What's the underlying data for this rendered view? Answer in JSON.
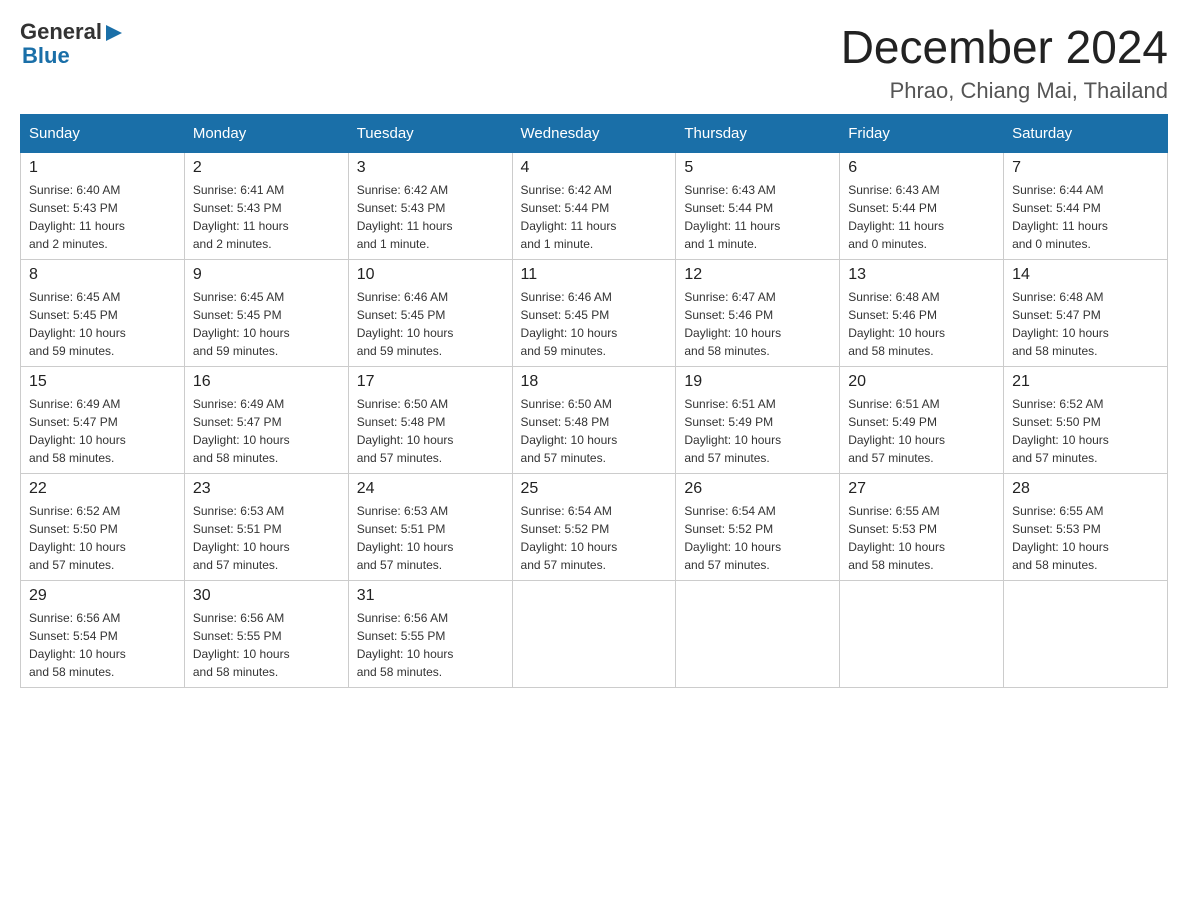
{
  "header": {
    "logo_general": "General",
    "logo_blue": "Blue",
    "month_title": "December 2024",
    "location": "Phrao, Chiang Mai, Thailand"
  },
  "days_of_week": [
    "Sunday",
    "Monday",
    "Tuesday",
    "Wednesday",
    "Thursday",
    "Friday",
    "Saturday"
  ],
  "weeks": [
    [
      {
        "day": "1",
        "sunrise": "6:40 AM",
        "sunset": "5:43 PM",
        "daylight": "11 hours and 2 minutes."
      },
      {
        "day": "2",
        "sunrise": "6:41 AM",
        "sunset": "5:43 PM",
        "daylight": "11 hours and 2 minutes."
      },
      {
        "day": "3",
        "sunrise": "6:42 AM",
        "sunset": "5:43 PM",
        "daylight": "11 hours and 1 minute."
      },
      {
        "day": "4",
        "sunrise": "6:42 AM",
        "sunset": "5:44 PM",
        "daylight": "11 hours and 1 minute."
      },
      {
        "day": "5",
        "sunrise": "6:43 AM",
        "sunset": "5:44 PM",
        "daylight": "11 hours and 1 minute."
      },
      {
        "day": "6",
        "sunrise": "6:43 AM",
        "sunset": "5:44 PM",
        "daylight": "11 hours and 0 minutes."
      },
      {
        "day": "7",
        "sunrise": "6:44 AM",
        "sunset": "5:44 PM",
        "daylight": "11 hours and 0 minutes."
      }
    ],
    [
      {
        "day": "8",
        "sunrise": "6:45 AM",
        "sunset": "5:45 PM",
        "daylight": "10 hours and 59 minutes."
      },
      {
        "day": "9",
        "sunrise": "6:45 AM",
        "sunset": "5:45 PM",
        "daylight": "10 hours and 59 minutes."
      },
      {
        "day": "10",
        "sunrise": "6:46 AM",
        "sunset": "5:45 PM",
        "daylight": "10 hours and 59 minutes."
      },
      {
        "day": "11",
        "sunrise": "6:46 AM",
        "sunset": "5:45 PM",
        "daylight": "10 hours and 59 minutes."
      },
      {
        "day": "12",
        "sunrise": "6:47 AM",
        "sunset": "5:46 PM",
        "daylight": "10 hours and 58 minutes."
      },
      {
        "day": "13",
        "sunrise": "6:48 AM",
        "sunset": "5:46 PM",
        "daylight": "10 hours and 58 minutes."
      },
      {
        "day": "14",
        "sunrise": "6:48 AM",
        "sunset": "5:47 PM",
        "daylight": "10 hours and 58 minutes."
      }
    ],
    [
      {
        "day": "15",
        "sunrise": "6:49 AM",
        "sunset": "5:47 PM",
        "daylight": "10 hours and 58 minutes."
      },
      {
        "day": "16",
        "sunrise": "6:49 AM",
        "sunset": "5:47 PM",
        "daylight": "10 hours and 58 minutes."
      },
      {
        "day": "17",
        "sunrise": "6:50 AM",
        "sunset": "5:48 PM",
        "daylight": "10 hours and 57 minutes."
      },
      {
        "day": "18",
        "sunrise": "6:50 AM",
        "sunset": "5:48 PM",
        "daylight": "10 hours and 57 minutes."
      },
      {
        "day": "19",
        "sunrise": "6:51 AM",
        "sunset": "5:49 PM",
        "daylight": "10 hours and 57 minutes."
      },
      {
        "day": "20",
        "sunrise": "6:51 AM",
        "sunset": "5:49 PM",
        "daylight": "10 hours and 57 minutes."
      },
      {
        "day": "21",
        "sunrise": "6:52 AM",
        "sunset": "5:50 PM",
        "daylight": "10 hours and 57 minutes."
      }
    ],
    [
      {
        "day": "22",
        "sunrise": "6:52 AM",
        "sunset": "5:50 PM",
        "daylight": "10 hours and 57 minutes."
      },
      {
        "day": "23",
        "sunrise": "6:53 AM",
        "sunset": "5:51 PM",
        "daylight": "10 hours and 57 minutes."
      },
      {
        "day": "24",
        "sunrise": "6:53 AM",
        "sunset": "5:51 PM",
        "daylight": "10 hours and 57 minutes."
      },
      {
        "day": "25",
        "sunrise": "6:54 AM",
        "sunset": "5:52 PM",
        "daylight": "10 hours and 57 minutes."
      },
      {
        "day": "26",
        "sunrise": "6:54 AM",
        "sunset": "5:52 PM",
        "daylight": "10 hours and 57 minutes."
      },
      {
        "day": "27",
        "sunrise": "6:55 AM",
        "sunset": "5:53 PM",
        "daylight": "10 hours and 58 minutes."
      },
      {
        "day": "28",
        "sunrise": "6:55 AM",
        "sunset": "5:53 PM",
        "daylight": "10 hours and 58 minutes."
      }
    ],
    [
      {
        "day": "29",
        "sunrise": "6:56 AM",
        "sunset": "5:54 PM",
        "daylight": "10 hours and 58 minutes."
      },
      {
        "day": "30",
        "sunrise": "6:56 AM",
        "sunset": "5:55 PM",
        "daylight": "10 hours and 58 minutes."
      },
      {
        "day": "31",
        "sunrise": "6:56 AM",
        "sunset": "5:55 PM",
        "daylight": "10 hours and 58 minutes."
      },
      null,
      null,
      null,
      null
    ]
  ],
  "labels": {
    "sunrise": "Sunrise:",
    "sunset": "Sunset:",
    "daylight": "Daylight:"
  }
}
